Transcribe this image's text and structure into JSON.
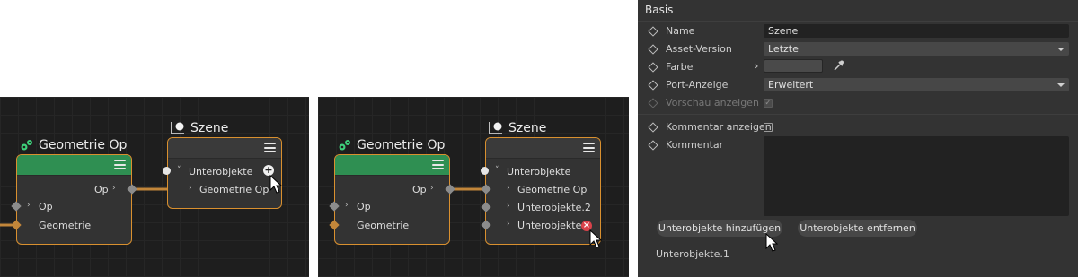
{
  "panel1": {
    "geometry_node": {
      "title": "Geometrie Op",
      "output_port": "Op",
      "input_op": "Op",
      "input_geometry": "Geometrie"
    },
    "scene_node": {
      "title": "Szene",
      "group": "Unterobjekte",
      "child": "Geometrie Op"
    },
    "cursor_badge": "+"
  },
  "panel2": {
    "geometry_node": {
      "title": "Geometrie Op",
      "output_port": "Op",
      "input_op": "Op",
      "input_geometry": "Geometrie"
    },
    "scene_node": {
      "title": "Szene",
      "group": "Unterobjekte",
      "children": [
        "Geometrie Op",
        "Unterobjekte.2",
        "Unterobjekte.3"
      ]
    },
    "cursor_badge": "×"
  },
  "attributes": {
    "section": "Basis",
    "name_label": "Name",
    "name_value": "Szene",
    "asset_label": "Asset-Version",
    "asset_value": "Letzte",
    "color_label": "Farbe",
    "port_label": "Port-Anzeige",
    "port_value": "Erweitert",
    "preview_label": "Vorschau anzeigen",
    "show_comment_label": "Kommentar anzeigen",
    "comment_label": "Kommentar",
    "add_button": "Unterobjekte hinzufügen",
    "remove_button": "Unterobjekte entfernen",
    "child_entry": "Unterobjekte.1"
  },
  "colors": {
    "accent_orange": "#d9902f",
    "header_green": "#2f8f52",
    "panel_dark": "#1e1e1e",
    "attr_bg": "#333333"
  }
}
